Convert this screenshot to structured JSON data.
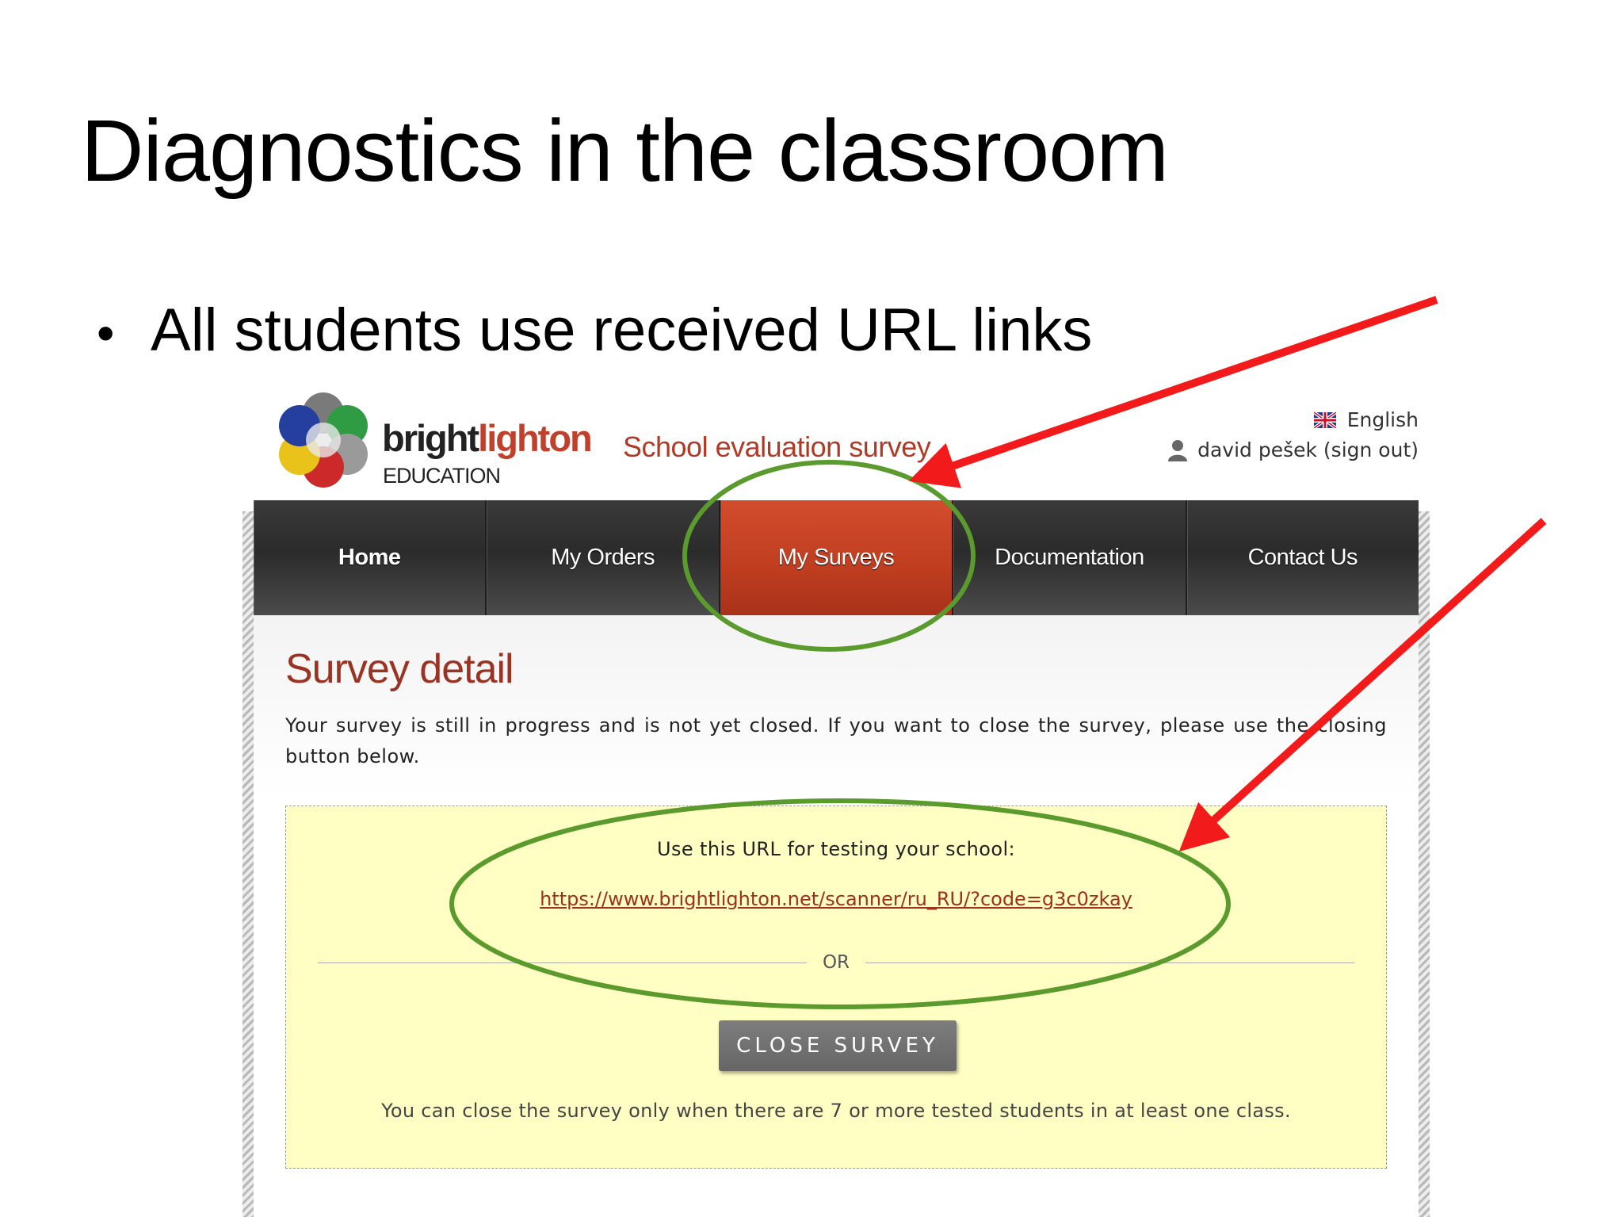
{
  "slide": {
    "title": "Diagnostics in the classroom",
    "bullet": "All students use received URL links"
  },
  "site": {
    "brand_prefix": "bright",
    "brand_accent": "lighton",
    "brand_sub": "EDUCATION",
    "app_name": "School evaluation survey",
    "language": "English",
    "user": "david pešek (sign out)",
    "nav": [
      {
        "label": "Home",
        "active": false
      },
      {
        "label": "My Orders",
        "active": false
      },
      {
        "label": "My Surveys",
        "active": true
      },
      {
        "label": "Documentation",
        "active": false
      },
      {
        "label": "Contact Us",
        "active": false
      }
    ],
    "heading": "Survey detail",
    "progress_text": "Your survey is still in progress and is not yet closed. If you want to close the survey, please use the closing button below.",
    "url_caption": "Use this URL for testing your school:",
    "url": "https://www.brightlighton.net/scanner/ru_RU/?code=g3c0zkay",
    "or_text": "OR",
    "close_button": "CLOSE SURVEY",
    "close_note": "You can close the survey only when there are 7 or more tested students in at least one class."
  },
  "icons": [
    "uk-flag-icon",
    "user-icon",
    "logo-flower-icon"
  ],
  "colors": {
    "accent": "#c0402b",
    "nav_active": "#c4401f",
    "highlight_box": "#ffffc4",
    "annotation_arrow": "#f21a1a",
    "annotation_circle": "#5b9a2c"
  }
}
